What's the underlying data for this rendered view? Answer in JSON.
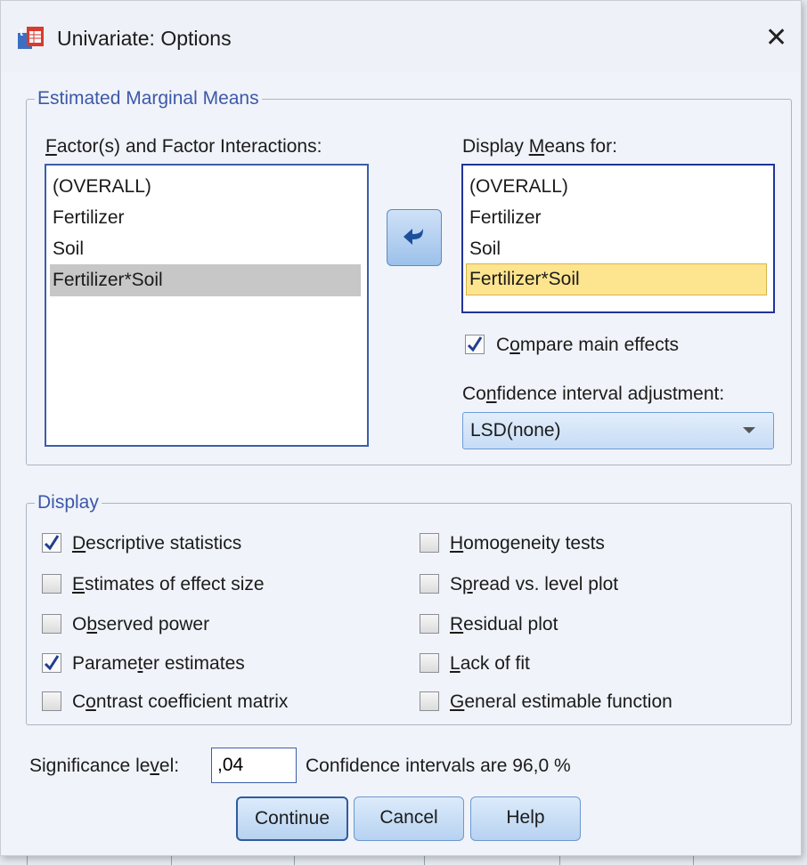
{
  "window": {
    "title": "Univariate: Options",
    "close_glyph": "✕"
  },
  "emm": {
    "legend": "Estimated Marginal Means",
    "factors_label": {
      "pre": "",
      "key": "F",
      "post": "actor(s) and Factor Interactions:"
    },
    "factors_items": [
      "(OVERALL)",
      "Fertilizer",
      "Soil",
      "Fertilizer*Soil"
    ],
    "display_label": {
      "pre": "Display ",
      "key": "M",
      "post": "eans for:"
    },
    "display_items": [
      "(OVERALL)",
      "Fertilizer",
      "Soil",
      "Fertilizer*Soil"
    ],
    "move_button_icon": "arrow-left-icon",
    "compare": {
      "pre": "C",
      "key": "o",
      "post": "mpare main effects",
      "checked": true
    },
    "ci_label": {
      "pre": "Co",
      "key": "n",
      "post": "fidence interval adjustment:"
    },
    "ci_value": "LSD(none)"
  },
  "display": {
    "legend": "Display",
    "left": [
      {
        "pre": "",
        "key": "D",
        "post": "escriptive statistics",
        "checked": true
      },
      {
        "pre": "",
        "key": "E",
        "post": "stimates of effect size",
        "checked": false
      },
      {
        "pre": "O",
        "key": "b",
        "post": "served power",
        "checked": false
      },
      {
        "pre": "Parame",
        "key": "t",
        "post": "er estimates",
        "checked": true
      },
      {
        "pre": "C",
        "key": "o",
        "post": "ntrast coefficient matrix",
        "checked": false
      }
    ],
    "right": [
      {
        "pre": "",
        "key": "H",
        "post": "omogeneity tests",
        "checked": false
      },
      {
        "pre": "S",
        "key": "p",
        "post": "read vs. level plot",
        "checked": false
      },
      {
        "pre": "",
        "key": "R",
        "post": "esidual plot",
        "checked": false
      },
      {
        "pre": "",
        "key": "L",
        "post": "ack of fit",
        "checked": false
      },
      {
        "pre": "",
        "key": "G",
        "post": "eneral estimable function",
        "checked": false
      }
    ]
  },
  "significance": {
    "label": {
      "pre": "Significance le",
      "key": "v",
      "post": "el:"
    },
    "value": ",04",
    "ci_text": "Confidence intervals are 96,0 %"
  },
  "buttons": {
    "continue": "Continue",
    "cancel": "Cancel",
    "help": "Help"
  },
  "colors": {
    "accent": "#3b5fa8",
    "legend_text": "#3d58a8",
    "selected_yellow": "#fde58f",
    "selected_gray": "#c7c7c7"
  }
}
